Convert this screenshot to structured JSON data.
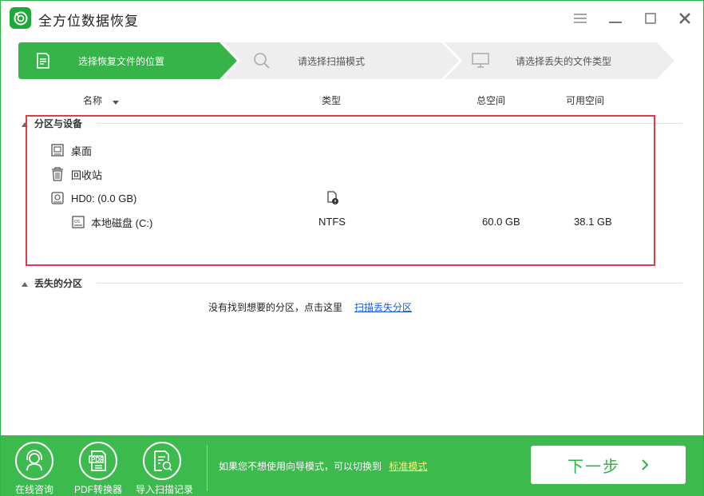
{
  "app": {
    "title": "全方位数据恢复"
  },
  "steps": [
    {
      "label": "选择恢复文件的位置",
      "active": true
    },
    {
      "label": "请选择扫描模式",
      "active": false
    },
    {
      "label": "请选择丢失的文件类型",
      "active": false
    }
  ],
  "columns": {
    "name": "名称",
    "type": "类型",
    "total": "总空间",
    "free": "可用空间"
  },
  "section_devices": {
    "title": "分区与设备",
    "items": [
      {
        "name": "桌面",
        "type": "",
        "total": "",
        "free": ""
      },
      {
        "name": "回收站",
        "type": "",
        "total": "",
        "free": ""
      },
      {
        "name": "HD0:  (0.0 GB)",
        "type": "",
        "total": "",
        "free": ""
      },
      {
        "name": "本地磁盘 (C:)",
        "type": "NTFS",
        "total": "60.0 GB",
        "free": "38.1 GB"
      }
    ]
  },
  "section_lost": {
    "title": "丢失的分区",
    "message": "没有找到想要的分区，点击这里",
    "link": "扫描丢失分区"
  },
  "bottom": {
    "tools": [
      {
        "label": "在线咨询",
        "icon": "headset-icon"
      },
      {
        "label": "PDF转换器",
        "icon": "pdf-icon",
        "badge": "PDF"
      },
      {
        "label": "导入扫描记录",
        "icon": "import-record-icon"
      }
    ],
    "message": "如果您不想使用向导模式，可以切换到",
    "mode_link": "标准模式",
    "next_label": "下一步"
  },
  "colors": {
    "accent": "#2fb344",
    "highlight": "#e0394a",
    "bottom": "#3dba4e"
  }
}
